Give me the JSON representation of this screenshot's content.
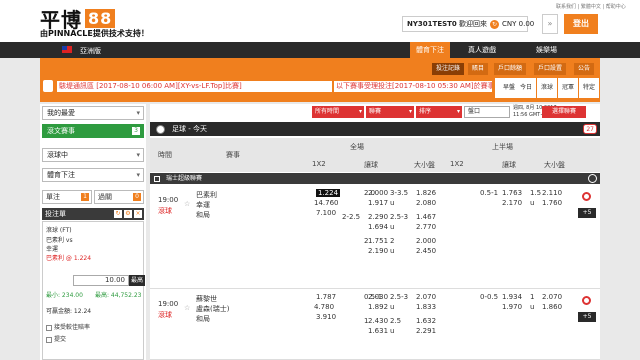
{
  "brand": {
    "name": "平博",
    "num": "88",
    "tagline": "由PINNACLE提供技术支持！"
  },
  "header": {
    "account": "NY301TEST0",
    "welcome": "歡迎回來",
    "currency": "CNY 0.00",
    "logout": "登出",
    "links": "联系我们 | 繁體中文 | 帮助中心"
  },
  "nav": {
    "region": "亞洲版",
    "tabs": [
      "體育下注",
      "真人遊戲",
      "娛樂場"
    ]
  },
  "menu": {
    "items": [
      "投注記錄",
      "賬目",
      "戶口餘額",
      "戶口設置",
      "公告"
    ]
  },
  "tabs": {
    "items": [
      "早盤",
      "今日",
      "滾球",
      "冠軍",
      "特定"
    ]
  },
  "announcements": {
    "label": "駭堤通訊區",
    "text1": "[2017-08-10 06:00 AM][XY-vs-LF.Top]比賽]",
    "text2": "以下賽事受理投注[2017-08-10 05:30 AM]於賽事取消"
  },
  "sidebar": {
    "myfav": "我的最愛",
    "live": "滾文賽事",
    "live_count": "3",
    "inplay": "滾球中",
    "betslip_mode": "體育下注",
    "half": "單注",
    "half_count": "1",
    "parlay": "過關",
    "parlay_count": "0",
    "betslip": "投注單"
  },
  "slip": {
    "sport": "滾球 (FT)",
    "teams": "巴素利 vs",
    "team2": "幸運",
    "pick": "巴素利",
    "odds": "1.224",
    "stake": "10.00",
    "max_label": "最高",
    "min_label": "最小: 234.00",
    "max_win_label": "最高: 44,752.23",
    "win": "可贏金額: 12.24",
    "accept": "接受較佳賠率",
    "ok": "提交"
  },
  "main": {
    "filters": [
      "所有時間",
      "聯賽",
      "排序"
    ],
    "odds_type": "盤口",
    "odds_fmt": "盤口",
    "clock_line1": "週四, 8月 10 2017",
    "clock_line2": "11:56 GMT+01:00",
    "refresh": "選擇聯賽",
    "sport_title": "足球 - 今天",
    "count": "27",
    "th_time": "時間",
    "th_match": "賽事",
    "th_full": "全場",
    "th_half": "上半場",
    "th_1x2": "1X2",
    "th_hdp": "讓球",
    "th_ou": "大小盤",
    "league": "瑞士超級聯賽"
  },
  "matches": [
    {
      "time": "19:00",
      "live": "滾球",
      "home": "巴素利",
      "away": "幸運",
      "draw": "和局",
      "x1": "1.224",
      "x2": "14.760",
      "x3": "7.100",
      "lines": [
        [
          "",
          "2.0",
          "2.000",
          "3-3.5",
          "1.826",
          "0.5-1",
          "1.763",
          "1.5",
          "2.110"
        ],
        [
          "",
          "",
          "1.917",
          "u",
          "2.080",
          "",
          "2.170",
          "u",
          "1.760"
        ],
        [
          "2-2.5",
          "",
          "2.290",
          "2.5-3",
          "1.467",
          "",
          "",
          "",
          ""
        ],
        [
          "",
          "",
          "1.694",
          "u",
          "2.770",
          "",
          "",
          "",
          ""
        ],
        [
          "",
          "2",
          "1.751",
          "2",
          "2.000",
          "",
          "",
          "",
          ""
        ],
        [
          "",
          "",
          "2.190",
          "u",
          "2.450",
          "",
          "",
          "",
          ""
        ]
      ]
    },
    {
      "time": "19:00",
      "live": "滾球",
      "home": "蘇黎世",
      "away": "盧森(瑞士)",
      "draw": "和局",
      "x1": "1.787",
      "x2": "4.780",
      "x3": "3.910",
      "lines": [
        [
          "",
          "0.5-1",
          "2.030",
          "2.5-3",
          "2.070",
          "0-0.5",
          "1.934",
          "1",
          "2.070"
        ],
        [
          "",
          "",
          "1.892",
          "u",
          "1.833",
          "",
          "1.970",
          "u",
          "1.860"
        ],
        [
          "",
          "1",
          "2.430",
          "2.5",
          "1.632",
          "",
          "",
          "",
          ""
        ],
        [
          "",
          "",
          "1.631",
          "u",
          "2.291",
          "",
          "",
          "",
          ""
        ]
      ]
    }
  ],
  "colors": {
    "accent": "#f07f1e",
    "dark": "#2a2a2a",
    "red": "#dd3333"
  }
}
